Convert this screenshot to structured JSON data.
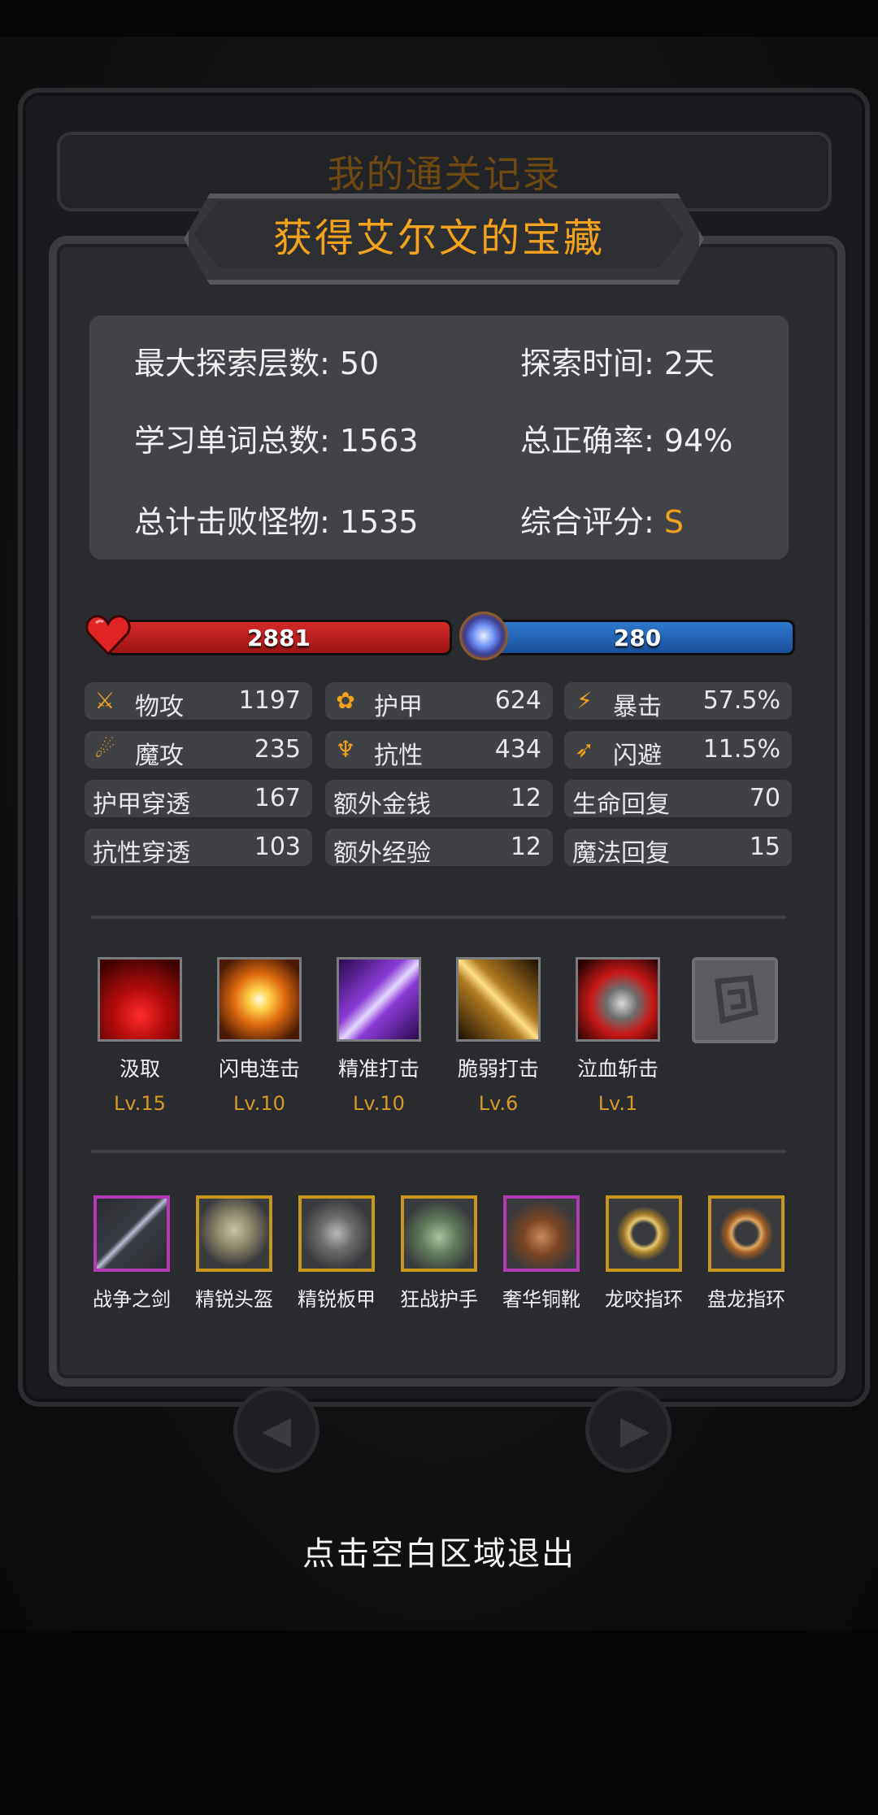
{
  "back_title": "我的通关记录",
  "panel_title": "获得艾尔文的宝藏",
  "summary": {
    "max_floor": "最大探索层数: 50",
    "time": "探索时间: 2天",
    "words": "学习单词总数: 1563",
    "accuracy": "总正确率: 94%",
    "kills": "总计击败怪物: 1535",
    "grade_label": "综合评分: ",
    "grade": "S"
  },
  "bars": {
    "hp": "2881",
    "mp": "280"
  },
  "stats": [
    {
      "icon": "sword-icon",
      "label": "物攻",
      "value": "1197"
    },
    {
      "icon": "paw-icon",
      "label": "护甲",
      "value": "624"
    },
    {
      "icon": "lightning-icon",
      "label": "暴击",
      "value": "57.5%"
    },
    {
      "icon": "magic-icon",
      "label": "魔攻",
      "value": "235"
    },
    {
      "icon": "resist-icon",
      "label": "抗性",
      "value": "434"
    },
    {
      "icon": "run-icon",
      "label": "闪避",
      "value": "11.5%"
    },
    {
      "label": "护甲穿透",
      "value": "167"
    },
    {
      "label": "额外金钱",
      "value": "12"
    },
    {
      "label": "生命回复",
      "value": "70"
    },
    {
      "label": "抗性穿透",
      "value": "103"
    },
    {
      "label": "额外经验",
      "value": "12"
    },
    {
      "label": "魔法回复",
      "value": "15"
    }
  ],
  "skills": [
    {
      "name": "汲取",
      "level": "Lv.15"
    },
    {
      "name": "闪电连击",
      "level": "Lv.10"
    },
    {
      "name": "精准打击",
      "level": "Lv.10"
    },
    {
      "name": "脆弱打击",
      "level": "Lv.6"
    },
    {
      "name": "泣血斩击",
      "level": "Lv.1"
    }
  ],
  "items": [
    {
      "name": "战争之剑"
    },
    {
      "name": "精锐头盔"
    },
    {
      "name": "精锐板甲"
    },
    {
      "name": "狂战护手"
    },
    {
      "name": "奢华铜靴"
    },
    {
      "name": "龙咬指环"
    },
    {
      "name": "盘龙指环"
    }
  ],
  "exit_hint": "点击空白区域退出"
}
